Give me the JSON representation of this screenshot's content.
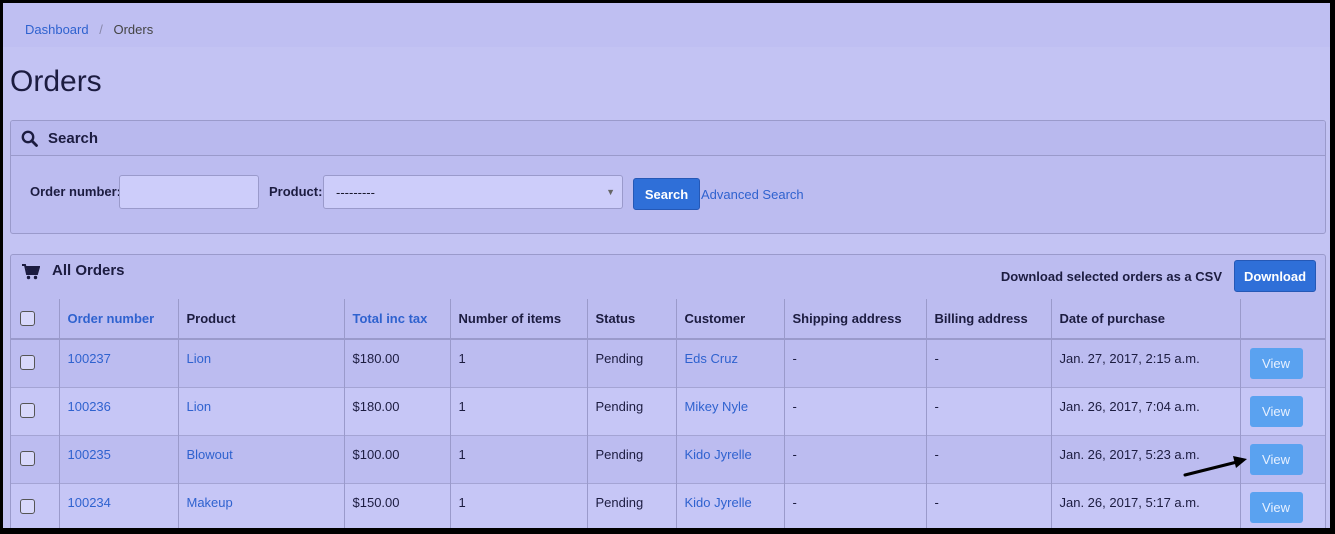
{
  "breadcrumb": {
    "home": "Dashboard",
    "separator": "/",
    "current": "Orders"
  },
  "page": {
    "title": "Orders"
  },
  "search_panel": {
    "title": "Search",
    "order_number_label": "Order number:",
    "order_number_value": "",
    "product_label": "Product:",
    "product_selected": "---------",
    "search_button": "Search",
    "advanced_link": "Advanced Search"
  },
  "orders_panel": {
    "title": "All Orders",
    "csv_text": "Download selected orders as a CSV",
    "download_button": "Download"
  },
  "table": {
    "headers": {
      "order_number": "Order number",
      "product": "Product",
      "total": "Total inc tax",
      "items": "Number of items",
      "status": "Status",
      "customer": "Customer",
      "shipping": "Shipping address",
      "billing": "Billing address",
      "date": "Date of purchase"
    },
    "rows": [
      {
        "order_number": "100237",
        "product": "Lion",
        "total": "$180.00",
        "items": "1",
        "status": "Pending",
        "customer": "Eds Cruz",
        "shipping": "-",
        "billing": "-",
        "date": "Jan. 27, 2017, 2:15 a.m.",
        "action": "View"
      },
      {
        "order_number": "100236",
        "product": "Lion",
        "total": "$180.00",
        "items": "1",
        "status": "Pending",
        "customer": "Mikey Nyle",
        "shipping": "-",
        "billing": "-",
        "date": "Jan. 26, 2017, 7:04 a.m.",
        "action": "View"
      },
      {
        "order_number": "100235",
        "product": "Blowout",
        "total": "$100.00",
        "items": "1",
        "status": "Pending",
        "customer": "Kido Jyrelle",
        "shipping": "-",
        "billing": "-",
        "date": "Jan. 26, 2017, 5:23 a.m.",
        "action": "View"
      },
      {
        "order_number": "100234",
        "product": "Makeup",
        "total": "$150.00",
        "items": "1",
        "status": "Pending",
        "customer": "Kido Jyrelle",
        "shipping": "-",
        "billing": "-",
        "date": "Jan. 26, 2017, 5:17 a.m.",
        "action": "View"
      }
    ]
  },
  "icons": {
    "search": "search-icon",
    "cart": "shopping-cart-icon",
    "annotation": "arrow-annotation-icon"
  },
  "colors": {
    "accent": "#2f6fd8",
    "link": "#2f62cf",
    "view_button": "#5aa2f0",
    "background": "#c3c3f3"
  }
}
